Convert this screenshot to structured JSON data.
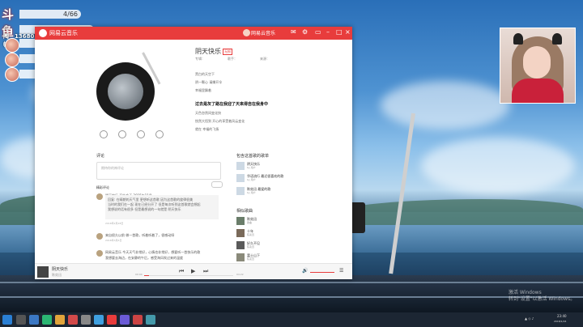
{
  "overlay": {
    "logo": "斗鱼",
    "rows": [
      {
        "label": "",
        "value": "4/66"
      },
      {
        "label": "",
        "value": "6/10"
      },
      {
        "label": "",
        "value": "0/5"
      },
      {
        "label": "",
        "value": "191/888"
      },
      {
        "label": "",
        "value": "0/88"
      }
    ],
    "username": "斗陶帕",
    "room": "1368050"
  },
  "window": {
    "app_title": "网易云音乐",
    "user_name": "网易云音乐",
    "song": {
      "title": "阴天快乐",
      "tag": "无损",
      "album_label": "专辑：",
      "singer_label": "歌手：",
      "source_label": "来源："
    },
    "lyrics": [
      "黑白的天空下",
      "阴一颗心 请撑开伞",
      "幸福里飘着",
      "过去是灰了路在我迎了天来得自在我身中",
      "天色忽然间变化快",
      "恍然大悟到 开心的享受着风云变化",
      "就在 幸福的飞扬"
    ],
    "comments_title": "评论",
    "comment_placeholder": "期待你的神评论",
    "hot_comments_title": "精彩评论",
    "comment_lines": [
      "阴天快乐 开始今天 2015年11月",
      "回复: 在晴朗的天气里 更想听这首歌 因为这首歌的旋律很美",
      "当时的我们在一起 现在已经分开了 但是每次听到这首歌就会想起",
      "我想说的话有很多 但是最想说的一句就是 阴天快乐",
      "2016年2月28日",
      "来自很久以前 做一首歌，听着听着了，很感动呀",
      "2016年3月6日",
      "网易云音乐 今天天气非常好，心情也非常好，想要听一首快乐的歌",
      "我想要去海边，在安静的午后，感受海风吹过来的温度"
    ],
    "similar_title": "包含这首歌的歌单",
    "similar": [
      {
        "name": "阴天快乐",
        "sub": "by 用户"
      },
      {
        "name": "华语流行 最近很喜欢的歌",
        "sub": "by 用户"
      },
      {
        "name": "陈奕迅 最爱的歌",
        "sub": "by 用户"
      }
    ],
    "similar_songs_title": "相似歌曲",
    "similar_songs": [
      {
        "name": "陈奕迅",
        "sub": "歌曲"
      },
      {
        "name": "十年",
        "sub": "陈奕迅"
      },
      {
        "name": "好久不见",
        "sub": "陈奕迅"
      },
      {
        "name": "富士山下",
        "sub": "陈奕迅"
      }
    ],
    "player": {
      "song": "阴天快乐",
      "artist": "陈奕迅",
      "time_current": "00:00",
      "time_total": "04:22",
      "progress": 0.05
    }
  },
  "desktop": {
    "watermark_line1": "激活 Windows",
    "watermark_line2": "转到\"设置\"以激活 Windows。",
    "clock_time": "23:40",
    "clock_date": "2018/1/24"
  },
  "colors": {
    "accent": "#e83c3c"
  }
}
